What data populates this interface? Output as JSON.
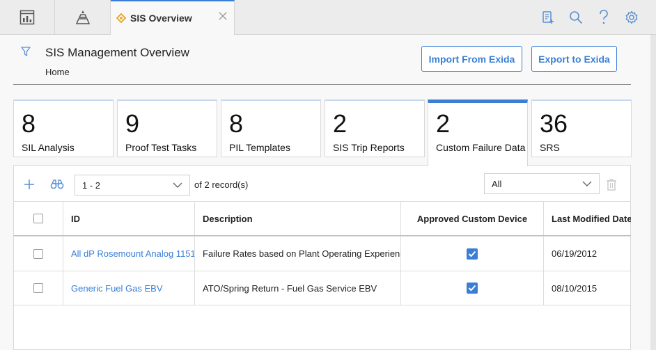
{
  "tab": {
    "label": "SIS Overview"
  },
  "header": {
    "title": "SIS Management Overview",
    "breadcrumb": "Home",
    "import_label": "Import From Exida",
    "export_label": "Export to Exida"
  },
  "tiles": [
    {
      "count": "8",
      "label": "SIL Analysis"
    },
    {
      "count": "9",
      "label": "Proof Test Tasks"
    },
    {
      "count": "8",
      "label": "PIL Templates"
    },
    {
      "count": "2",
      "label": "SIS Trip Reports"
    },
    {
      "count": "2",
      "label": "Custom Failure Data"
    },
    {
      "count": "36",
      "label": "SRS"
    }
  ],
  "active_tile": "Custom Failure Data",
  "grid": {
    "pager": "1 - 2",
    "of_text": "of",
    "record_count": "2",
    "records_label": "record(s)",
    "filter_value": "All",
    "columns": [
      "ID",
      "Description",
      "Approved Custom Device",
      "Last Modified Date"
    ],
    "rows": [
      {
        "id": "All dP Rosemount Analog 1151",
        "description": "Failure Rates based on Plant Operating Experience",
        "approved": true,
        "modified": "06/19/2012"
      },
      {
        "id": "Generic Fuel Gas EBV",
        "description": "ATO/Spring Return - Fuel Gas Service EBV",
        "approved": true,
        "modified": "08/10/2015"
      }
    ]
  },
  "colors": {
    "accent": "#3a7fd5",
    "icon": "#5a8fd0"
  },
  "icons": [
    "dashboard-icon",
    "asset-hierarchy-icon",
    "sis-tab-icon",
    "close-icon",
    "queries-icon",
    "search-icon",
    "help-icon",
    "settings-icon",
    "filter-icon",
    "add-icon",
    "binoculars-icon",
    "chevron-down-icon",
    "delete-icon",
    "checkbox-checked-icon"
  ]
}
